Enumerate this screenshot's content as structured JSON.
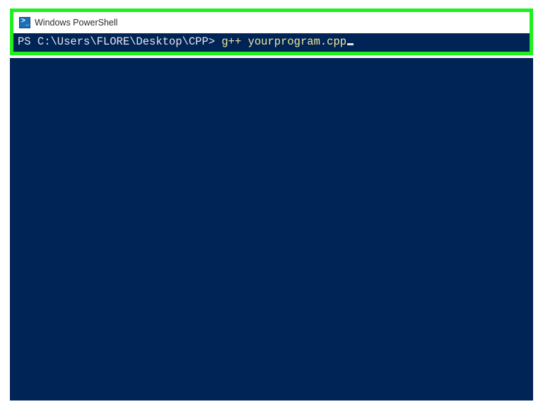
{
  "window": {
    "title": "Windows PowerShell"
  },
  "terminal": {
    "prompt": "PS C:\\Users\\FLORE\\Desktop\\CPP> ",
    "command": "g++ yourprogram.cpp"
  }
}
